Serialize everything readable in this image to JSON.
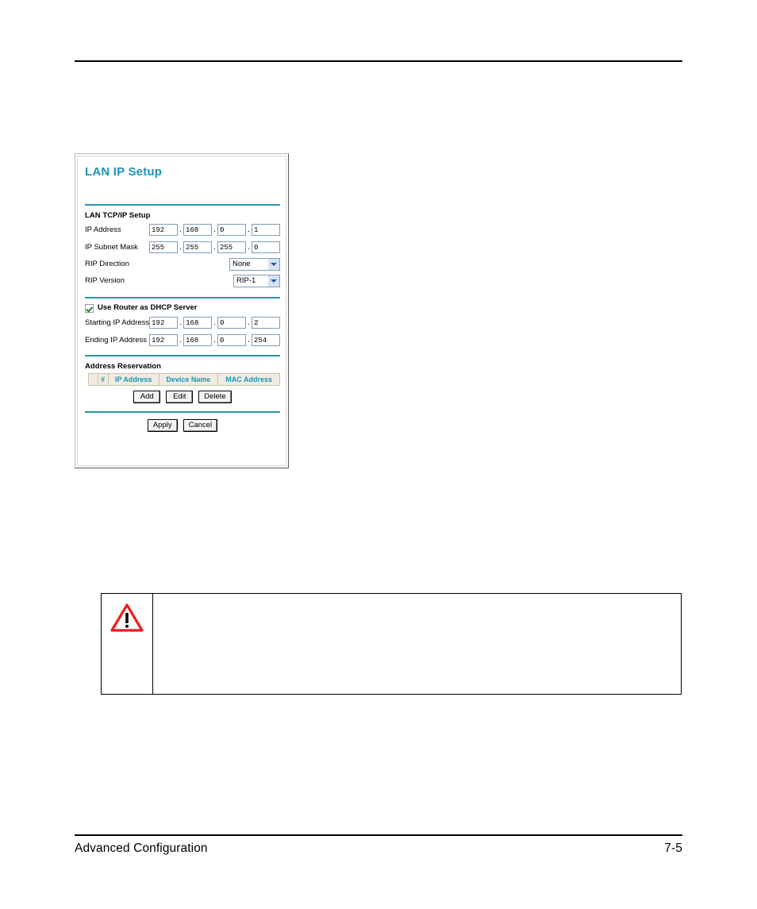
{
  "document": {
    "footer_left": "Advanced Configuration",
    "footer_page": "7-5"
  },
  "figure": {
    "panel": {
      "title": "LAN IP Setup",
      "sections": {
        "tcpip_label": "LAN TCP/IP Setup",
        "address_reservation_label": "Address Reservation"
      },
      "fields": {
        "ip_address": {
          "label": "IP Address",
          "octets": [
            "192",
            "168",
            "0",
            "1"
          ],
          "separator": "."
        },
        "ip_subnet_mask": {
          "label": "IP Subnet Mask",
          "octets": [
            "255",
            "255",
            "255",
            "0"
          ],
          "separator": "."
        },
        "rip_direction": {
          "label": "RIP Direction",
          "value": "None"
        },
        "rip_version": {
          "label": "RIP Version",
          "value": "RIP-1"
        },
        "dhcp_checkbox": {
          "label": "Use Router as DHCP Server",
          "checked": true
        },
        "starting_ip": {
          "label": "Starting IP Address",
          "octets": [
            "192",
            "168",
            "0",
            "2"
          ],
          "separator": "."
        },
        "ending_ip": {
          "label": "Ending IP Address",
          "octets": [
            "192",
            "168",
            "0",
            "254"
          ],
          "separator": "."
        }
      },
      "reservation_table": {
        "headers": [
          "",
          "#",
          "IP Address",
          "Device Name",
          "MAC Address"
        ],
        "rows": []
      },
      "table_buttons": [
        "Add",
        "Edit",
        "Delete"
      ],
      "form_buttons": [
        "Apply",
        "Cancel"
      ]
    }
  },
  "note": {
    "icon": "warning-triangle-icon",
    "text": ""
  },
  "colors": {
    "panel_title_teal": "#1b94b5",
    "divider_teal": "#2a93ab",
    "table_header_bg": "#f0ece1",
    "input_border_blue": "#7f9db9",
    "select_arrow_blue": "#2457a8",
    "checkbox_check_green": "#158a2e",
    "warning_red": "#ee1c1c"
  }
}
